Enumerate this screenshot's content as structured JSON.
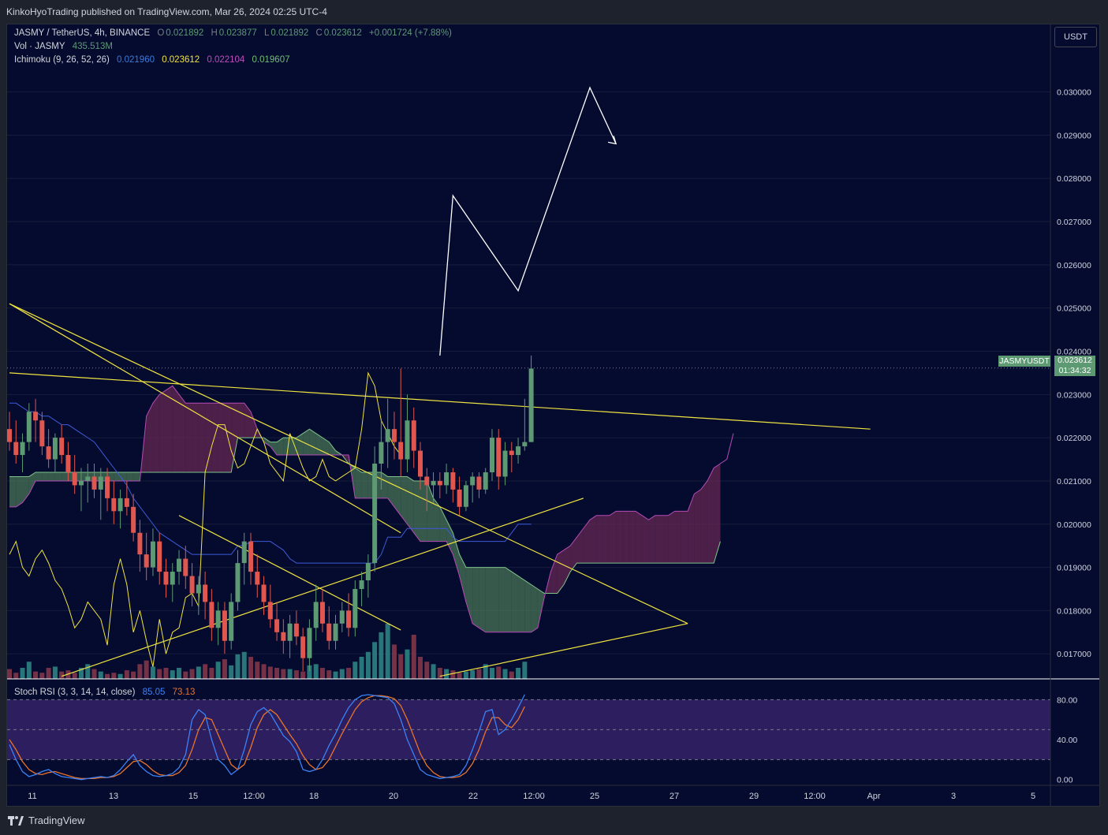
{
  "header": {
    "published": "KinkoHyoTrading published on TradingView.com, Mar 26, 2024 02:25 UTC-4"
  },
  "legend": {
    "symbol": "JASMY / TetherUS, 4h, BINANCE",
    "o_label": "O",
    "o_value": "0.021892",
    "h_label": "H",
    "h_value": "0.023877",
    "l_label": "L",
    "l_value": "0.021892",
    "c_label": "C",
    "c_value": "0.023612",
    "change": "+0.001724 (+7.88%)",
    "vol_label": "Vol · JASMY",
    "vol_value": "435.513M",
    "ichimoku_label": "Ichimoku (9, 26, 52, 26)",
    "ichimoku_values": [
      "0.021960",
      "0.023612",
      "0.022104",
      "0.019607"
    ],
    "stoch_label": "Stoch RSI (3, 3, 14, 14, close)",
    "stoch_k": "85.05",
    "stoch_d": "73.13"
  },
  "price_axis": {
    "currency": "USDT",
    "last_price": "0.023612",
    "countdown": "01:34:32",
    "symbol_badge": "JASMYUSDT"
  },
  "footer": {
    "brand": "TradingView"
  },
  "colors": {
    "background": "#050b2e",
    "up": "#5d9a73",
    "down": "#e0574f",
    "yellow": "#f0e442",
    "white": "#ffffff",
    "kijun_blue": "#3d5bd9",
    "cloud_green": "#4d7a5a",
    "cloud_red": "#6b2a55",
    "stoch_k": "#3b82f6",
    "stoch_d": "#e8742e",
    "stoch_band": "#3a2670"
  },
  "chart_data": {
    "type": "candlestick",
    "price_ticks": [
      "0.030000",
      "0.029000",
      "0.028000",
      "0.027000",
      "0.026000",
      "0.025000",
      "0.024000",
      "0.023000",
      "0.022000",
      "0.021000",
      "0.020000",
      "0.019000",
      "0.018000",
      "0.017000"
    ],
    "stoch_ticks": [
      "80.00",
      "40.00",
      "0.00"
    ],
    "time_ticks": [
      "11",
      "13",
      "15",
      "12:00",
      "18",
      "20",
      "22",
      "12:00",
      "25",
      "27",
      "29",
      "12:00",
      "Apr",
      "3",
      "5"
    ],
    "price_range": [
      0.01642,
      0.03158
    ],
    "stoch_range": [
      -5,
      100
    ],
    "candles": [
      [
        0.0222,
        0.0226,
        0.0217,
        0.0219
      ],
      [
        0.0219,
        0.0224,
        0.0214,
        0.0216
      ],
      [
        0.0216,
        0.0221,
        0.0212,
        0.0219
      ],
      [
        0.0219,
        0.0228,
        0.0217,
        0.0226
      ],
      [
        0.0226,
        0.0229,
        0.0219,
        0.0224
      ],
      [
        0.0224,
        0.0226,
        0.0216,
        0.0218
      ],
      [
        0.0218,
        0.0222,
        0.0213,
        0.0215
      ],
      [
        0.0215,
        0.0221,
        0.0212,
        0.022
      ],
      [
        0.022,
        0.0223,
        0.0214,
        0.0216
      ],
      [
        0.0216,
        0.0219,
        0.021,
        0.0212
      ],
      [
        0.0212,
        0.0216,
        0.0207,
        0.0209
      ],
      [
        0.0209,
        0.0213,
        0.0203,
        0.021
      ],
      [
        0.021,
        0.0214,
        0.0205,
        0.0211
      ],
      [
        0.0211,
        0.0214,
        0.0206,
        0.0208
      ],
      [
        0.0208,
        0.0213,
        0.0201,
        0.0211
      ],
      [
        0.0211,
        0.0213,
        0.0203,
        0.0206
      ],
      [
        0.0206,
        0.021,
        0.02,
        0.0203
      ],
      [
        0.0203,
        0.0208,
        0.0199,
        0.0206
      ],
      [
        0.0206,
        0.021,
        0.0202,
        0.0204
      ],
      [
        0.0204,
        0.0207,
        0.0196,
        0.0198
      ],
      [
        0.0198,
        0.0201,
        0.0189,
        0.0193
      ],
      [
        0.0193,
        0.0198,
        0.0187,
        0.019
      ],
      [
        0.019,
        0.0199,
        0.0188,
        0.0196
      ],
      [
        0.0196,
        0.0198,
        0.0186,
        0.0189
      ],
      [
        0.0189,
        0.0192,
        0.0183,
        0.0186
      ],
      [
        0.0186,
        0.0191,
        0.0182,
        0.0189
      ],
      [
        0.0189,
        0.0194,
        0.0186,
        0.0192
      ],
      [
        0.0192,
        0.0195,
        0.0185,
        0.0188
      ],
      [
        0.0188,
        0.0191,
        0.0181,
        0.0184
      ],
      [
        0.0184,
        0.0188,
        0.0179,
        0.0186
      ],
      [
        0.0186,
        0.0189,
        0.0178,
        0.0182
      ],
      [
        0.0182,
        0.0185,
        0.0173,
        0.0176
      ],
      [
        0.0176,
        0.0182,
        0.0172,
        0.018
      ],
      [
        0.018,
        0.0182,
        0.017,
        0.0173
      ],
      [
        0.0173,
        0.0184,
        0.0171,
        0.0182
      ],
      [
        0.0182,
        0.0194,
        0.018,
        0.0191
      ],
      [
        0.0191,
        0.0198,
        0.0186,
        0.0196
      ],
      [
        0.0196,
        0.0198,
        0.0186,
        0.0189
      ],
      [
        0.0189,
        0.0193,
        0.0183,
        0.0186
      ],
      [
        0.0186,
        0.0188,
        0.0179,
        0.0182
      ],
      [
        0.0182,
        0.0186,
        0.0176,
        0.0178
      ],
      [
        0.0178,
        0.0182,
        0.0173,
        0.0175
      ],
      [
        0.0175,
        0.0178,
        0.017,
        0.0173
      ],
      [
        0.0173,
        0.0179,
        0.0169,
        0.0177
      ],
      [
        0.0177,
        0.018,
        0.0172,
        0.0174
      ],
      [
        0.0174,
        0.0176,
        0.0166,
        0.0169
      ],
      [
        0.0169,
        0.0178,
        0.0166,
        0.0176
      ],
      [
        0.0176,
        0.0186,
        0.0173,
        0.0182
      ],
      [
        0.0182,
        0.0185,
        0.0175,
        0.0177
      ],
      [
        0.0177,
        0.0181,
        0.0171,
        0.0173
      ],
      [
        0.0173,
        0.0179,
        0.0171,
        0.0177
      ],
      [
        0.0177,
        0.0182,
        0.0175,
        0.018
      ],
      [
        0.018,
        0.0184,
        0.0174,
        0.0176
      ],
      [
        0.0176,
        0.0187,
        0.0174,
        0.0185
      ],
      [
        0.0185,
        0.0189,
        0.0181,
        0.0187
      ],
      [
        0.0187,
        0.0193,
        0.0183,
        0.0191
      ],
      [
        0.0191,
        0.0218,
        0.0189,
        0.0214
      ],
      [
        0.0214,
        0.0224,
        0.0208,
        0.0219
      ],
      [
        0.0219,
        0.0229,
        0.0213,
        0.0222
      ],
      [
        0.0222,
        0.0226,
        0.0215,
        0.0219
      ],
      [
        0.0219,
        0.0236,
        0.0211,
        0.0215
      ],
      [
        0.0215,
        0.023,
        0.0212,
        0.0224
      ],
      [
        0.0224,
        0.0227,
        0.0213,
        0.0217
      ],
      [
        0.0217,
        0.0219,
        0.0208,
        0.0211
      ],
      [
        0.0211,
        0.0213,
        0.0203,
        0.0209
      ],
      [
        0.0209,
        0.0212,
        0.0205,
        0.021
      ],
      [
        0.021,
        0.0212,
        0.0206,
        0.0209
      ],
      [
        0.0209,
        0.0214,
        0.0207,
        0.0212
      ],
      [
        0.0212,
        0.0213,
        0.0205,
        0.0208
      ],
      [
        0.0208,
        0.0211,
        0.0202,
        0.0204
      ],
      [
        0.0204,
        0.021,
        0.0203,
        0.0209
      ],
      [
        0.0209,
        0.0212,
        0.0205,
        0.0211
      ],
      [
        0.0211,
        0.0212,
        0.0206,
        0.0208
      ],
      [
        0.0208,
        0.0213,
        0.0207,
        0.0212
      ],
      [
        0.0212,
        0.0222,
        0.021,
        0.022
      ],
      [
        0.022,
        0.0222,
        0.0208,
        0.0211
      ],
      [
        0.0211,
        0.0219,
        0.0209,
        0.0217
      ],
      [
        0.0217,
        0.0219,
        0.0212,
        0.0216
      ],
      [
        0.0216,
        0.022,
        0.0214,
        0.0218
      ],
      [
        0.0218,
        0.0229,
        0.0217,
        0.0219
      ],
      [
        0.0219,
        0.0239,
        0.0219,
        0.0236
      ]
    ],
    "volume": [
      8,
      5,
      9,
      14,
      6,
      5,
      9,
      10,
      6,
      7,
      5,
      9,
      12,
      8,
      6,
      4,
      5,
      4,
      7,
      6,
      12,
      15,
      10,
      8,
      9,
      7,
      9,
      6,
      8,
      10,
      12,
      9,
      14,
      16,
      11,
      20,
      22,
      18,
      14,
      12,
      10,
      9,
      8,
      8,
      7,
      6,
      11,
      12,
      9,
      7,
      6,
      8,
      9,
      14,
      18,
      22,
      30,
      38,
      45,
      28,
      20,
      24,
      36,
      18,
      14,
      12,
      9,
      8,
      7,
      5,
      6,
      7,
      8,
      12,
      9,
      10,
      8,
      6,
      9,
      14
    ],
    "ichimoku": {
      "tenkan": [
        0.0228,
        0.0228,
        0.0226,
        0.0226,
        0.0226,
        0.0225,
        0.0225,
        0.0225,
        0.0225,
        0.0225,
        0.0223,
        0.0223,
        0.0223,
        0.0221,
        0.0221,
        0.0219,
        0.0217,
        0.0215,
        0.0212,
        0.021,
        0.0208,
        0.0207,
        0.0205,
        0.0204,
        0.0202,
        0.02,
        0.0198,
        0.0197,
        0.0196,
        0.0194,
        0.0193,
        0.0191,
        0.0189,
        0.0188,
        0.0188,
        0.0188,
        0.0188,
        0.019,
        0.019,
        0.019,
        0.0189,
        0.0188,
        0.0186,
        0.0185,
        0.0183,
        0.0182,
        0.0181,
        0.018,
        0.018,
        0.0179,
        0.018,
        0.0181,
        0.0183,
        0.0185,
        0.0189,
        0.019,
        0.0194,
        0.02,
        0.0208,
        0.0209,
        0.0211,
        0.0215,
        0.0213,
        0.0212,
        0.021,
        0.0208,
        0.0207,
        0.0205,
        0.0205,
        0.0203,
        0.0201,
        0.0198,
        0.0198,
        0.0198,
        0.0198,
        0.02,
        0.0204,
        0.0208,
        0.0209,
        0.021,
        0.0211
      ],
      "kijun_vals": [
        0.0228,
        0.0228,
        0.0227,
        0.0226,
        0.0226,
        0.0225,
        0.0225,
        0.0224,
        0.0223,
        0.0223,
        0.0222,
        0.0221,
        0.022,
        0.0219,
        0.0217,
        0.0215,
        0.0213,
        0.0211,
        0.0209,
        0.0206,
        0.0204,
        0.0202,
        0.02,
        0.0198,
        0.0197,
        0.0196,
        0.0195,
        0.0194,
        0.0193,
        0.0193,
        0.0193,
        0.0193,
        0.0193,
        0.0193,
        0.0193,
        0.0195,
        0.0195,
        0.0196,
        0.0196,
        0.0196,
        0.0196,
        0.0195,
        0.0194,
        0.0192,
        0.0191,
        0.0191,
        0.0191,
        0.0191,
        0.0191,
        0.0191,
        0.0191,
        0.0191,
        0.0191,
        0.0191,
        0.0191,
        0.0191,
        0.0191,
        0.0193,
        0.0197,
        0.0197,
        0.0197,
        0.0199,
        0.0199,
        0.0199,
        0.0199,
        0.0199,
        0.0199,
        0.0199,
        0.0197,
        0.0196,
        0.0196,
        0.0196,
        0.0196,
        0.0196,
        0.0196,
        0.0196,
        0.0196,
        0.0198,
        0.02,
        0.02,
        0.02
      ],
      "chikou": [
        0.0193,
        0.0196,
        0.019,
        0.0188,
        0.0192,
        0.0194,
        0.0191,
        0.0187,
        0.0185,
        0.0181,
        0.0176,
        0.0178,
        0.0182,
        0.018,
        0.0178,
        0.0172,
        0.0186,
        0.0192,
        0.0186,
        0.0175,
        0.018,
        0.0173,
        0.0167,
        0.0178,
        0.017,
        0.0175,
        0.0176,
        0.0183,
        0.0184,
        0.0181,
        0.0212,
        0.0218,
        0.0223,
        0.0223,
        0.0217,
        0.0213,
        0.0214,
        0.0218,
        0.0222,
        0.0219,
        0.0214,
        0.0212,
        0.021,
        0.0221,
        0.0217,
        0.0213,
        0.021,
        0.0211,
        0.0215,
        0.0211,
        0.021,
        0.0211,
        0.0212,
        0.0213,
        0.0222,
        0.0235,
        0.0232,
        0.0224,
        0.0221,
        0.0218,
        0.0216
      ],
      "span_a": [
        0.0211,
        0.0211,
        0.0211,
        0.0211,
        0.0212,
        0.0212,
        0.0212,
        0.0212,
        0.0212,
        0.0212,
        0.0212,
        0.0212,
        0.0212,
        0.0212,
        0.0212,
        0.0212,
        0.0212,
        0.0212,
        0.0212,
        0.0212,
        0.0212,
        0.0212,
        0.0212,
        0.0212,
        0.0212,
        0.0212,
        0.0212,
        0.0212,
        0.0212,
        0.0212,
        0.0212,
        0.0212,
        0.0212,
        0.0212,
        0.0212,
        0.022,
        0.022,
        0.022,
        0.022,
        0.022,
        0.0219,
        0.0219,
        0.022,
        0.022,
        0.022,
        0.0221,
        0.0222,
        0.0221,
        0.022,
        0.0219,
        0.0217,
        0.0216,
        0.0214,
        0.0213,
        0.0212,
        0.0212,
        0.0212,
        0.0212,
        0.0211,
        0.0211,
        0.0211,
        0.0211,
        0.021,
        0.021,
        0.021,
        0.0206,
        0.0204,
        0.0201,
        0.0198,
        0.0193,
        0.019,
        0.019,
        0.019,
        0.019,
        0.019,
        0.019,
        0.019,
        0.0189,
        0.0188,
        0.0187,
        0.0186,
        0.0185,
        0.0184,
        0.0184,
        0.0184,
        0.0186,
        0.0189,
        0.0191,
        0.0191,
        0.0191,
        0.0191,
        0.0191,
        0.0191,
        0.0191,
        0.0191,
        0.0191,
        0.0191,
        0.0191,
        0.0191,
        0.0191,
        0.0191,
        0.0191,
        0.0191,
        0.0191,
        0.0191,
        0.0191,
        0.0191,
        0.0191,
        0.0191,
        0.0196
      ],
      "span_b": [
        0.0204,
        0.0204,
        0.0205,
        0.0207,
        0.021,
        0.021,
        0.021,
        0.021,
        0.021,
        0.021,
        0.021,
        0.021,
        0.021,
        0.021,
        0.021,
        0.021,
        0.021,
        0.021,
        0.021,
        0.021,
        0.021,
        0.0225,
        0.0228,
        0.023,
        0.0231,
        0.0232,
        0.023,
        0.0228,
        0.0228,
        0.0228,
        0.0228,
        0.0228,
        0.0228,
        0.0228,
        0.0228,
        0.0228,
        0.0228,
        0.0226,
        0.0222,
        0.0219,
        0.0218,
        0.0216,
        0.0216,
        0.0216,
        0.0216,
        0.0216,
        0.0216,
        0.0216,
        0.0216,
        0.0216,
        0.0216,
        0.0216,
        0.0216,
        0.0206,
        0.0206,
        0.0206,
        0.0206,
        0.0206,
        0.0206,
        0.0204,
        0.0202,
        0.02,
        0.0198,
        0.0196,
        0.0196,
        0.0196,
        0.0196,
        0.0196,
        0.0193,
        0.0188,
        0.0182,
        0.0177,
        0.0176,
        0.0175,
        0.0175,
        0.0175,
        0.0175,
        0.0175,
        0.0175,
        0.0175,
        0.0175,
        0.0176,
        0.0183,
        0.0189,
        0.0193,
        0.0194,
        0.0195,
        0.0197,
        0.0199,
        0.0201,
        0.0202,
        0.0202,
        0.0202,
        0.0203,
        0.0203,
        0.0203,
        0.0203,
        0.0202,
        0.0201,
        0.0202,
        0.0202,
        0.0202,
        0.0203,
        0.0203,
        0.0203,
        0.0207,
        0.0208,
        0.021,
        0.0213,
        0.0214,
        0.0215,
        0.0221
      ]
    },
    "stoch_k_series": [
      35,
      20,
      8,
      3,
      5,
      8,
      10,
      6,
      3,
      2,
      1,
      0,
      1,
      2,
      3,
      2,
      4,
      10,
      18,
      25,
      14,
      8,
      4,
      3,
      4,
      6,
      12,
      25,
      60,
      70,
      65,
      40,
      20,
      14,
      5,
      10,
      30,
      55,
      68,
      72,
      66,
      55,
      44,
      38,
      28,
      10,
      8,
      10,
      20,
      34,
      46,
      60,
      72,
      80,
      84,
      85,
      84,
      83,
      82,
      76,
      60,
      40,
      25,
      10,
      5,
      3,
      1,
      2,
      3,
      5,
      14,
      30,
      48,
      68,
      70,
      45,
      50,
      60,
      72,
      85
    ],
    "stoch_d_series": [
      40,
      30,
      18,
      10,
      6,
      5,
      7,
      8,
      6,
      4,
      2,
      1,
      1,
      1,
      2,
      2,
      3,
      6,
      12,
      18,
      19,
      15,
      9,
      5,
      4,
      4,
      7,
      14,
      30,
      50,
      62,
      60,
      45,
      30,
      15,
      10,
      15,
      32,
      52,
      65,
      70,
      65,
      55,
      45,
      36,
      24,
      15,
      10,
      12,
      20,
      33,
      46,
      58,
      70,
      78,
      82,
      84,
      84,
      83,
      81,
      74,
      60,
      43,
      26,
      14,
      7,
      3,
      2,
      2,
      3,
      7,
      16,
      30,
      48,
      62,
      62,
      55,
      52,
      60,
      73
    ],
    "trendlines": [
      {
        "from": [
          0,
          0.0251
        ],
        "to": [
          104,
          0.0177
        ]
      },
      {
        "from": [
          0,
          0.0251
        ],
        "to": [
          60,
          0.0198
        ]
      },
      {
        "from": [
          0,
          0.0235
        ],
        "to": [
          132,
          0.0222
        ]
      },
      {
        "from": [
          26,
          0.0202
        ],
        "to": [
          60,
          0.01755
        ]
      },
      {
        "from": [
          8,
          0.01648
        ],
        "to": [
          88,
          0.0206
        ]
      },
      {
        "from": [
          66,
          0.01648
        ],
        "to": [
          104,
          0.0177
        ]
      }
    ],
    "projection": [
      [
        66,
        0.0239
      ],
      [
        68,
        0.0276
      ],
      [
        78,
        0.0254
      ],
      [
        89,
        0.0301
      ],
      [
        93,
        0.0288
      ]
    ]
  }
}
